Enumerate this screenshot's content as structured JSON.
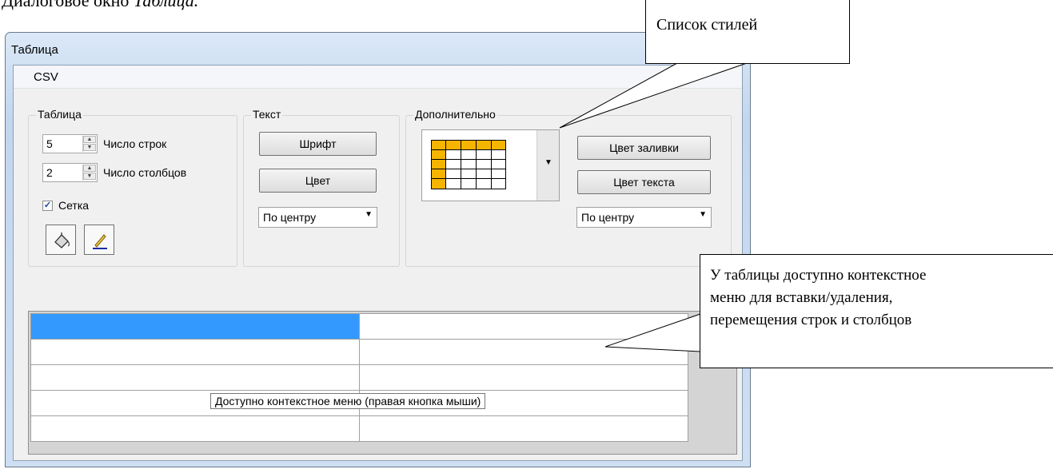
{
  "caption": {
    "prefix": "Диалоговое окно ",
    "italic": "Таблица."
  },
  "window": {
    "title": "Таблица"
  },
  "menu": {
    "items": [
      "CSV"
    ]
  },
  "group_table": {
    "title": "Таблица",
    "rows_value": "5",
    "rows_label": "Число строк",
    "cols_value": "2",
    "cols_label": "Число столбцов",
    "grid_checkbox_label": "Сетка",
    "grid_checked": true,
    "fill_tool_icon": "paint-bucket-icon",
    "pen_tool_icon": "pencil-icon"
  },
  "group_text": {
    "title": "Текст",
    "font_button": "Шрифт",
    "color_button": "Цвет",
    "align_value": "По центру"
  },
  "group_extra": {
    "title": "Дополнительно",
    "style_preview_icon": "table-style-preview-icon",
    "fill_color_button": "Цвет заливки",
    "text_color_button": "Цвет текста",
    "align_value": "По центру",
    "style_header_color": "#f5b400"
  },
  "grid": {
    "rows": 5,
    "cols": 2,
    "selected_cell": [
      0,
      0
    ],
    "selection_color": "#3399ff",
    "tooltip": "Доступно контекстное меню (правая кнопка мыши)"
  },
  "callouts": {
    "style_list": "Список стилей",
    "context_menu_lines": [
      "У таблицы доступно контекстное",
      "меню для вставки/удаления,",
      "перемещения строк и столбцов"
    ]
  }
}
